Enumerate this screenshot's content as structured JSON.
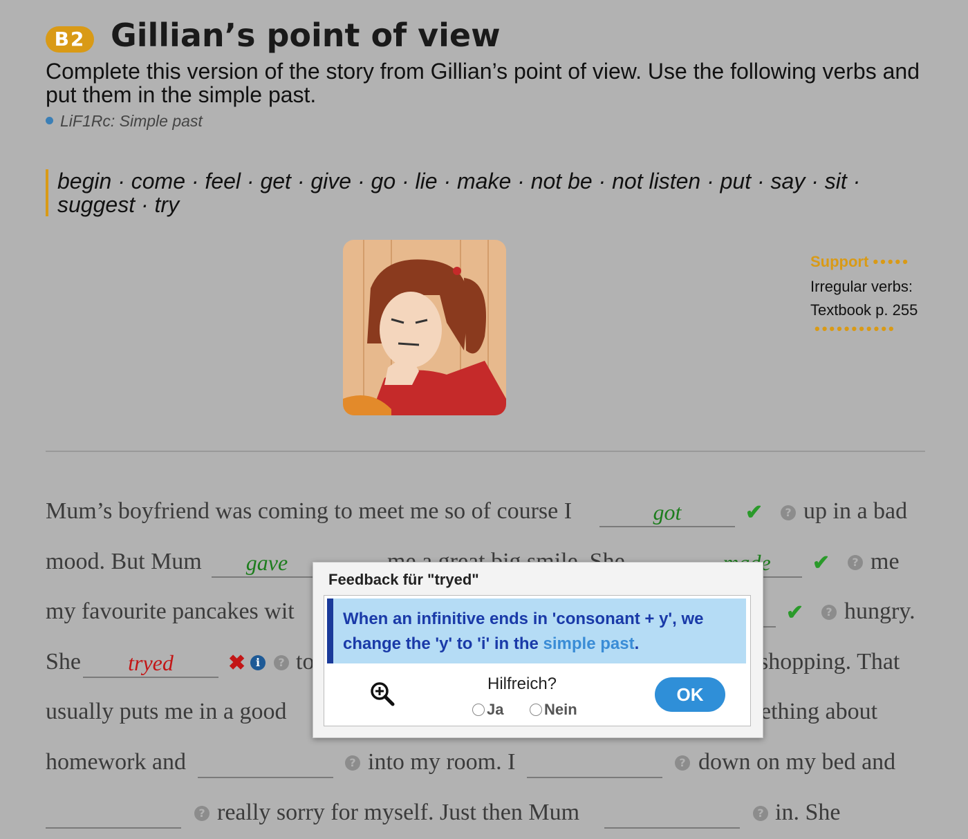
{
  "header": {
    "badge": "B2",
    "title": "Gillian’s point of view",
    "instruction": "Complete this version of the story from Gillian’s point of view. Use the following verbs and put them in the simple past.",
    "reference": "LiF1Rc: Simple past"
  },
  "verb_list": "begin · come · feel · get · give · go · lie · make · not be · not listen · put · say · sit · suggest · try",
  "support": {
    "label": "Support",
    "line1": "Irregular verbs:",
    "line2": "Textbook p. 255"
  },
  "story": {
    "l1a": "Mum’s boyfriend was coming to meet me so of course I",
    "l1b": "up in a bad",
    "l2a": "mood. But Mum",
    "l2b": "me a great big smile. She",
    "l2c": "me",
    "l3a": "my favourite pancakes wit",
    "l3b": "hungry.",
    "l4a": "She",
    "l4b": "to",
    "l4c": "shopping. That",
    "l5a": "usually puts me in a good",
    "l5b": "ething about",
    "l6a": "homework and",
    "l6b": "into my room. I",
    "l6c": "down on my bed and",
    "l7a": "really sorry for myself. Just then Mum",
    "l7b": "in. She"
  },
  "answers": {
    "a1": "got",
    "a2": "gave",
    "a3": "made",
    "a4": "tryed"
  },
  "dialog": {
    "title": "Feedback für \"tryed\"",
    "feedback_main": "When an infinitive ends in 'consonant + y', we change the 'y' to 'i' in the",
    "feedback_link": "simple past",
    "feedback_end": ".",
    "helpful_question": "Hilfreich?",
    "option_yes": "Ja",
    "option_no": "Nein",
    "ok_label": "OK"
  },
  "colors": {
    "accent": "#d99a16",
    "correct": "#1d7d1d",
    "wrong": "#c31616",
    "ok_button": "#2f8fd8",
    "feedback_bg": "#b5dcf5"
  }
}
